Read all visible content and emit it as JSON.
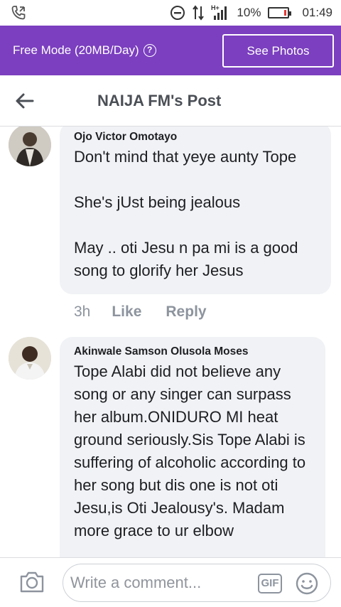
{
  "status_bar": {
    "battery": "10%",
    "time": "01:49",
    "icons": [
      "phone-call-icon",
      "do-not-disturb-icon",
      "data-transfer-icon",
      "signal-h-plus-icon",
      "battery-icon"
    ]
  },
  "free_mode": {
    "label": "Free Mode (20MB/Day)",
    "see_photos_label": "See Photos",
    "color": "#7b3fbf"
  },
  "header": {
    "title": "NAIJA FM's Post"
  },
  "comments": [
    {
      "author": "Ojo Victor Omotayo",
      "text": "Don't mind that yeye aunty Tope\n\nShe's jUst being jealous\n\nMay .. oti Jesu n pa mi is a good song to glorify her Jesus",
      "time": "3h",
      "like_label": "Like",
      "reply_label": "Reply"
    },
    {
      "author": "Akinwale Samson Olusola Moses",
      "text": "Tope Alabi did not believe any song or any singer can surpass her album.ONIDURO MI heat ground seriously.Sis Tope Alabi is suffering of alcoholic according to her song but dis one is not oti Jesu,is Oti Jealousy's. Madam more grace to ur elbow"
    }
  ],
  "composer": {
    "placeholder": "Write a comment...",
    "gif_label": "GIF"
  }
}
